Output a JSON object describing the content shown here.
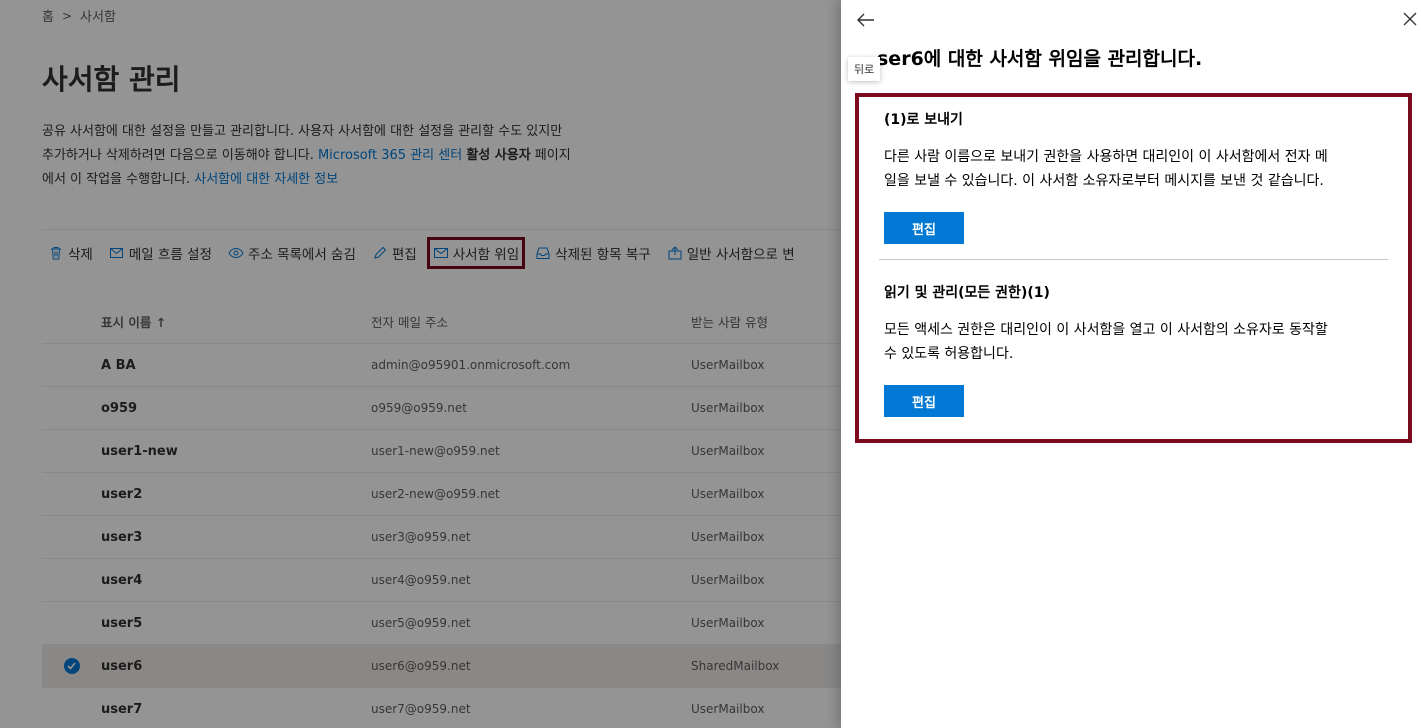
{
  "breadcrumb": {
    "home": "홈",
    "separator": ">",
    "current": "사서함"
  },
  "page": {
    "title": "사서함 관리",
    "desc_line1": "공유 사서함에 대한 설정을 만들고 관리합니다. 사용자 사서함에 대한 설정을 관리할 수도 있지만",
    "desc_line2_pre": "추가하거나 삭제하려면 다음으로 이동해야 합니다. ",
    "desc_line2_link": "Microsoft 365 관리 센터",
    "desc_line2_bold": "활성 사용자",
    "desc_line2_post": " 페이지",
    "desc_line3_pre": "에서 이 작업을 수행합니다. ",
    "desc_line3_link": "사서함에 대한 자세한 정보"
  },
  "toolbar": {
    "delete": "삭제",
    "mailflow": "메일 흐름 설정",
    "hide": "주소 목록에서 숨김",
    "edit": "편집",
    "delegation": "사서함 위임",
    "recover": "삭제된 항목 복구",
    "convert": "일반 사서함으로 변"
  },
  "table": {
    "headers": {
      "name": "표시 이름 ↑",
      "email": "전자 메일 주소",
      "type": "받는 사람 유형"
    },
    "rows": [
      {
        "name": "A BA",
        "email": "admin@o95901.onmicrosoft.com",
        "type": "UserMailbox"
      },
      {
        "name": "o959",
        "email": "o959@o959.net",
        "type": "UserMailbox"
      },
      {
        "name": "user1-new",
        "email": "user1-new@o959.net",
        "type": "UserMailbox"
      },
      {
        "name": "user2",
        "email": "user2-new@o959.net",
        "type": "UserMailbox"
      },
      {
        "name": "user3",
        "email": "user3@o959.net",
        "type": "UserMailbox"
      },
      {
        "name": "user4",
        "email": "user4@o959.net",
        "type": "UserMailbox"
      },
      {
        "name": "user5",
        "email": "user5@o959.net",
        "type": "UserMailbox"
      },
      {
        "name": "user6",
        "email": "user6@o959.net",
        "type": "SharedMailbox"
      },
      {
        "name": "user7",
        "email": "user7@o959.net",
        "type": "UserMailbox"
      }
    ]
  },
  "panel": {
    "back_tooltip": "뒤로",
    "title": "ser6에 대한 사서함 위임을 관리합니다.",
    "send_as": {
      "title": "(1)로 보내기",
      "line1": "다른 사람 이름으로 보내기 권한을 사용하면 대리인이 이 사서함에서 전자 메",
      "line2": "일을 보낼 수 있습니다. 이 사서함 소유자로부터 메시지를 보낸 것 같습니다.",
      "edit": "편집"
    },
    "full_access": {
      "title": "읽기 및 관리(모든 권한)(1)",
      "line1": "모든 액세스 권한은 대리인이 이 사서함을 열고 이 사서함의 소유자로 동작할",
      "line2": "수 있도록 허용합니다.",
      "edit": "편집"
    }
  },
  "colors": {
    "accent": "#0078d4",
    "highlight": "#7a0a1e"
  }
}
